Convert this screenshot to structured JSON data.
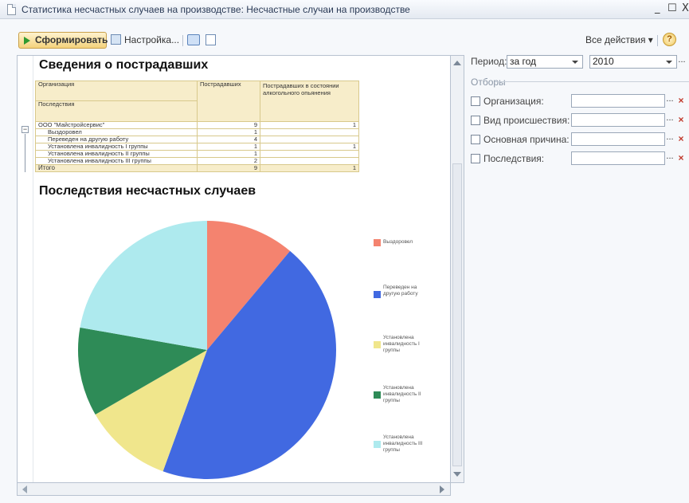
{
  "window": {
    "title": "Статистика несчастных случаев на производстве: Несчастные случаи на производстве",
    "minimize": "_",
    "maximize": "☐",
    "close": "X"
  },
  "toolbar": {
    "generate_label": "Сформировать",
    "settings_label": "Настройка...",
    "all_actions_label": "Все действия ▾",
    "help_label": "?"
  },
  "report": {
    "title": "Сведения о пострадавших",
    "table": {
      "header_org": "Организация",
      "header_consequences": "Последствия",
      "header_victims": "Пострадавших",
      "header_drunk": "Пострадавших в состоянии алкогольного опьянения",
      "rows": [
        {
          "label": "ООО \"Майстройсервис\"",
          "victims": "9",
          "drunk": "1"
        },
        {
          "label": "Выздоровел",
          "victims": "1",
          "drunk": ""
        },
        {
          "label": "Переведен на другую работу",
          "victims": "4",
          "drunk": ""
        },
        {
          "label": "Установлена инвалидность I группы",
          "victims": "1",
          "drunk": "1"
        },
        {
          "label": "Установлена инвалидность II группы",
          "victims": "1",
          "drunk": ""
        },
        {
          "label": "Установлена инвалидность III группы",
          "victims": "2",
          "drunk": ""
        }
      ],
      "total_label": "Итого",
      "total_victims": "9",
      "total_drunk": "1"
    },
    "chart_title": "Последствия несчастных случаев"
  },
  "chart_data": {
    "type": "pie",
    "title": "Последствия несчастных случаев",
    "legend_position": "right",
    "slices": [
      {
        "label": "Выздоровел",
        "value": 1,
        "color": "#f4836f"
      },
      {
        "label": "Переведен на другую работу",
        "value": 4,
        "color": "#4169e1"
      },
      {
        "label": "Установлена инвалидность I группы",
        "value": 1,
        "color": "#f0e68c"
      },
      {
        "label": "Установлена инвалидность II группы",
        "value": 1,
        "color": "#2e8b57"
      },
      {
        "label": "Установлена инвалидность III группы",
        "value": 2,
        "color": "#aeeaee"
      }
    ]
  },
  "settings": {
    "period_label": "Период:",
    "period_value": "за год",
    "year_value": "2010",
    "filters_label": "Отборы",
    "filters": [
      {
        "label": "Организация:",
        "value": ""
      },
      {
        "label": "Вид происшествия:",
        "value": ""
      },
      {
        "label": "Основная причина:",
        "value": ""
      },
      {
        "label": "Последствия:",
        "value": ""
      }
    ],
    "dots": "...",
    "clear": "×"
  }
}
